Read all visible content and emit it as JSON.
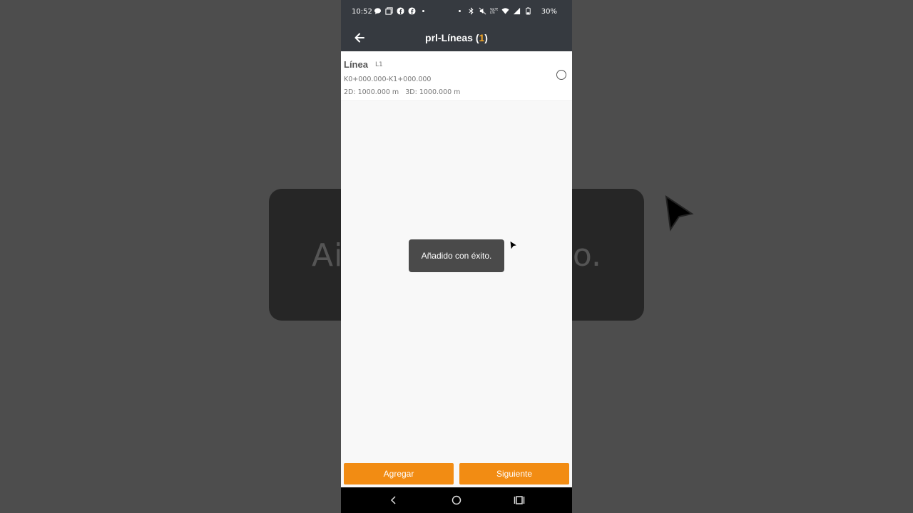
{
  "background": {
    "toast_left_fragment": "Ai",
    "toast_right_fragment": "o."
  },
  "status_bar": {
    "time": "10:52",
    "battery": "30%",
    "left_icons": [
      "chat-icon",
      "copy-icon",
      "facebook-icon",
      "facebook-icon",
      "dot-icon"
    ],
    "right_icons": [
      "dot-icon",
      "bluetooth-icon",
      "mute-icon",
      "volte-icon",
      "wifi-icon",
      "signal-icon",
      "battery-icon"
    ]
  },
  "app_bar": {
    "title_prefix": "prl-Líneas (",
    "count": "1",
    "title_suffix": ")",
    "accent_color": "#f5a623"
  },
  "list": {
    "items": [
      {
        "name": "Línea",
        "code": "L1",
        "range": "K0+000.000-K1+000.000",
        "lengths": "2D: 1000.000 m   3D: 1000.000 m"
      }
    ]
  },
  "toast": {
    "message": "Añadido con éxito."
  },
  "buttons": {
    "add_label": "Agregar",
    "next_label": "Siguiente",
    "color": "#f28c13"
  },
  "nav": {
    "back": "back-nav-icon",
    "home": "home-nav-icon",
    "recents": "recents-nav-icon"
  }
}
